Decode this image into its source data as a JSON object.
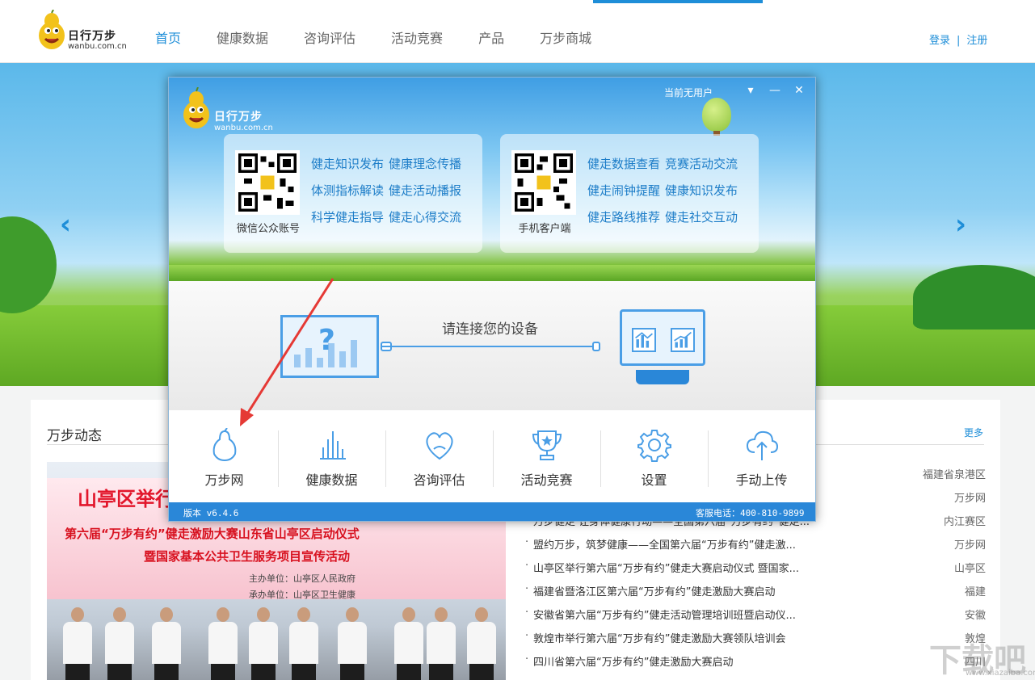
{
  "site": {
    "logo_brand": "日行万步",
    "logo_domain": "wanbu.com.cn",
    "nav": [
      "首页",
      "健康数据",
      "咨询评估",
      "活动竞赛",
      "产品",
      "万步商城"
    ],
    "login": "登录",
    "sep": "|",
    "register": "注册",
    "accent": "#1e8ed8"
  },
  "hero": {
    "prev": "‹",
    "next": "›"
  },
  "news": {
    "title": "万步动态",
    "more": "更多",
    "photo_texts": {
      "t1": "山亭区举行",
      "t2": "第六届“万步有约”健走激励大赛山东省山亭区启动仪式",
      "t3": "暨国家基本公共卫生服务项目宣传活动",
      "t4": "主办单位：山亭区人民政府",
      "t5": "承办单位：山亭区卫生健康"
    },
    "items": [
      {
        "title": "",
        "source": "福建省泉港区"
      },
      {
        "title": "",
        "source": "万步网"
      },
      {
        "title": "万步健走 让身体健康行动——全国第六届“万步有约”健走...",
        "source": "内江赛区"
      },
      {
        "title": "盟约万步，筑梦健康——全国第六届“万步有约”健走激...",
        "source": "万步网"
      },
      {
        "title": "山亭区举行第六届“万步有约”健走大赛启动仪式 暨国家...",
        "source": "山亭区"
      },
      {
        "title": "福建省暨洛江区第六届“万步有约”健走激励大赛启动",
        "source": "福建"
      },
      {
        "title": "安徽省第六届“万步有约”健走活动管理培训班暨启动仪...",
        "source": "安徽"
      },
      {
        "title": "敦煌市举行第六届“万步有约”健走激励大赛领队培训会",
        "source": "敦煌"
      },
      {
        "title": "四川省第六届“万步有约”健走激励大赛启动",
        "source": "四川"
      }
    ]
  },
  "app": {
    "logo_brand": "日行万步",
    "logo_domain": "wanbu.com.cn",
    "current_user": "当前无用户",
    "wechat": {
      "label": "微信公众账号",
      "links": [
        [
          "健走知识发布",
          "健康理念传播"
        ],
        [
          "体测指标解读",
          "健走活动播报"
        ],
        [
          "科学健走指导",
          "健走心得交流"
        ]
      ]
    },
    "mobile": {
      "label": "手机客户端",
      "links": [
        [
          "健走数据查看",
          "竞赛活动交流"
        ],
        [
          "健走闹钟提醒",
          "健康知识发布"
        ],
        [
          "健走路线推荐",
          "健走社交互动"
        ]
      ]
    },
    "connect_text": "请连接您的设备",
    "tools": [
      {
        "icon": "pear-icon",
        "label": "万步网"
      },
      {
        "icon": "bar-chart-icon",
        "label": "健康数据"
      },
      {
        "icon": "heart-chat-icon",
        "label": "咨询评估"
      },
      {
        "icon": "trophy-icon",
        "label": "活动竞赛"
      },
      {
        "icon": "gear-icon",
        "label": "设置"
      },
      {
        "icon": "cloud-upload-icon",
        "label": "手动上传"
      }
    ],
    "version": "版本 v6.4.6",
    "hotline": "客服电话：400-810-9899",
    "accent": "#2a87d8"
  },
  "watermark": {
    "main": "下载吧",
    "sub": "www.xiazaiba.com"
  }
}
